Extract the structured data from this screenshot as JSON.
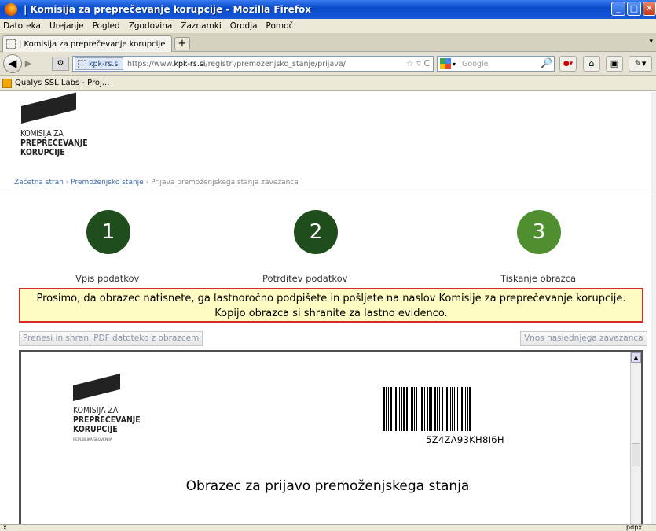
{
  "window": {
    "title": "| Komisija za preprečevanje korupcije - Mozilla Firefox"
  },
  "menu": [
    "Datoteka",
    "Urejanje",
    "Pogled",
    "Zgodovina",
    "Zaznamki",
    "Orodja",
    "Pomoč"
  ],
  "tab": {
    "label": "| Komisija za preprečevanje korupcije",
    "new_tab": "+"
  },
  "navigation": {
    "site_identity": "kpk-rs.si",
    "url_prefix": "https://www.",
    "url_domain": "kpk-rs.si",
    "url_path": "/registri/premozenjsko_stanje/prijava/",
    "search_engine": "Google"
  },
  "bookmarks": [
    {
      "label": "Qualys SSL Labs - Proj..."
    }
  ],
  "page": {
    "logo_line1": "KOMISIJA ZA",
    "logo_line2": "PREPREČEVANJE",
    "logo_line3": "KORUPCIJE",
    "breadcrumb": {
      "home": "Začetna stran",
      "sep": " › ",
      "section": "Premoženjsko stanje",
      "current": "Prijava premoženjskega stanja zavezanca"
    },
    "steps": [
      {
        "number": "1",
        "label": "Vpis podatkov",
        "color": "#1f4d1c"
      },
      {
        "number": "2",
        "label": "Potrditev podatkov",
        "color": "#1f4d1c"
      },
      {
        "number": "3",
        "label": "Tiskanje obrazca",
        "color": "#4f8f2f"
      }
    ],
    "notice_line1": "Prosimo, da obrazec natisnete, ga lastnoročno podpišete in pošljete na naslov Komisije za preprečevanje korupcije.",
    "notice_line2": "Kopijo obrazca si shranite za lastno evidenco.",
    "download_button": "Prenesi in shrani PDF datoteko z obrazcem",
    "next_button": "Vnos naslednjega zavezanca",
    "document": {
      "logo_line1": "KOMISIJA ZA",
      "logo_line2": "PREPREČEVANJE",
      "logo_line3": "KORUPCIJE",
      "republic": "REPUBLIKA SLOVENIJA",
      "barcode_text": "5Z4ZA93KH8I6H",
      "title": "Obrazec za prijavo premoženjskega stanja"
    }
  },
  "status": {
    "left": "x",
    "right": "pdpx"
  },
  "colors": {
    "notice_bg": "#fefcc2",
    "notice_border": "#d52b27",
    "step_done": "#1f4d1c",
    "step_current": "#4f8f2f"
  }
}
